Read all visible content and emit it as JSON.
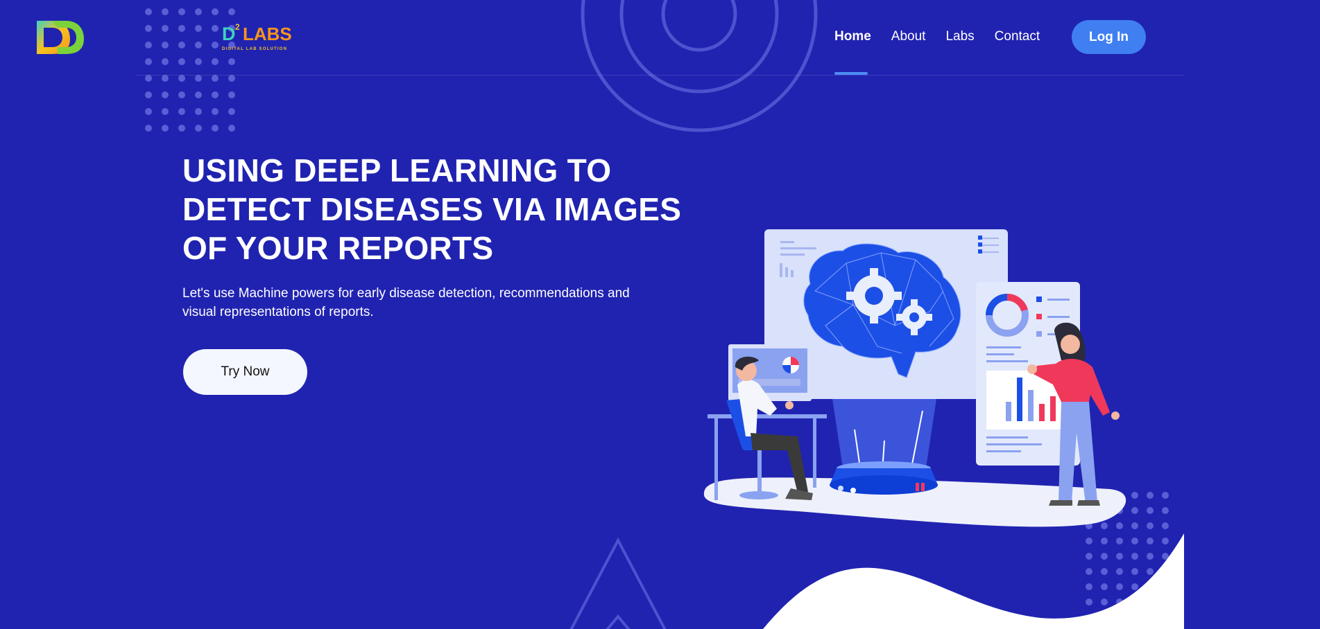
{
  "brand": {
    "logo_mark": "D",
    "logo_d2": "D",
    "logo_sup": "2",
    "logo_word": "LABS",
    "tagline": "DIGITAL LAB SOLUTION"
  },
  "nav": {
    "items": [
      {
        "label": "Home",
        "active": true
      },
      {
        "label": "About",
        "active": false
      },
      {
        "label": "Labs",
        "active": false
      },
      {
        "label": "Contact",
        "active": false
      }
    ],
    "login_label": "Log In"
  },
  "hero": {
    "title_lines": [
      "USING DEEP LEARNING TO",
      "DETECT DISEASES VIA IMAGES",
      "OF YOUR REPORTS"
    ],
    "description_lines": [
      "Let's use Machine powers for early disease detection, recommendations and",
      "visual representations of reports."
    ],
    "cta_label": "Try Now"
  },
  "colors": {
    "background": "#2023b0",
    "accent": "#3f7ff2",
    "logo_orange": "#f7941e",
    "logo_teal": "#3fd0c0",
    "illustration_blue": "#1c4fe6",
    "illustration_red": "#f0395a"
  },
  "icons": [
    "dots-pattern-icon",
    "concentric-circles-icon",
    "triangle-outline-icon",
    "brain-gears-icon",
    "donut-chart-icon",
    "bar-chart-icon"
  ]
}
